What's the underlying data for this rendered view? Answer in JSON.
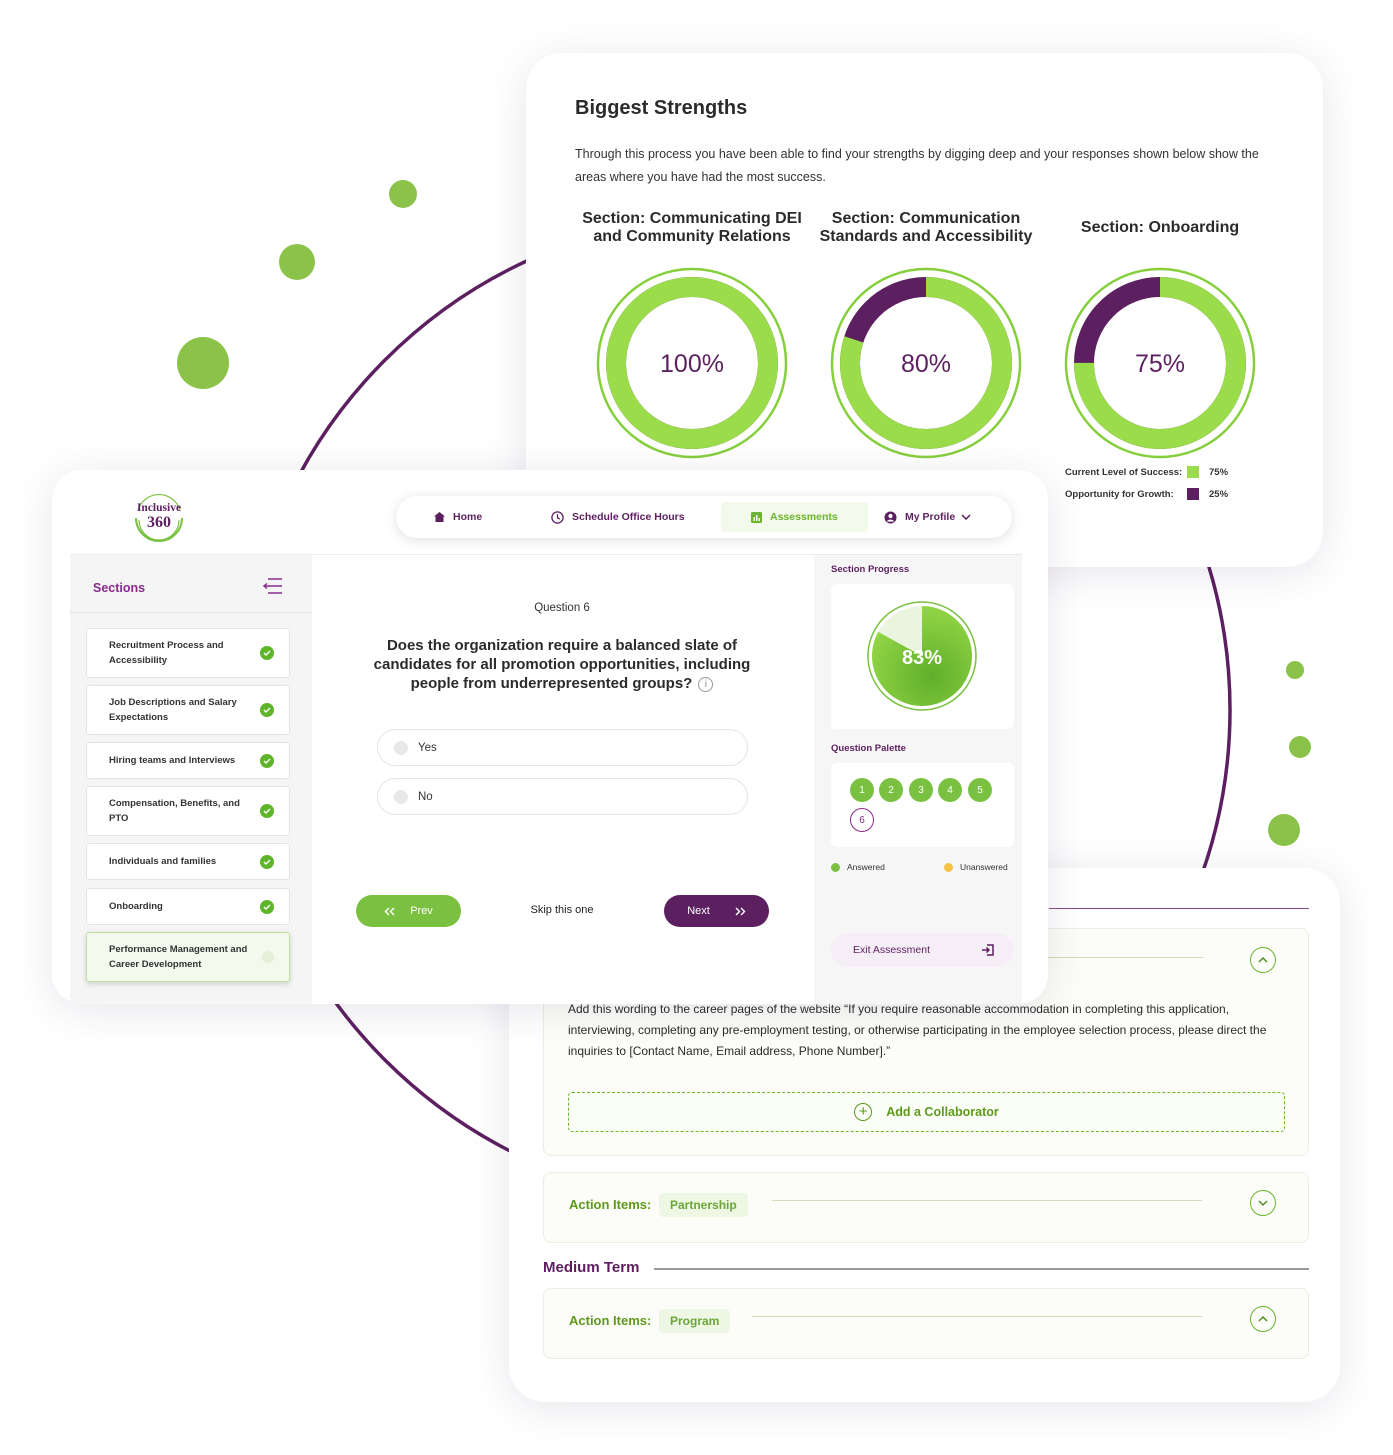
{
  "strengths": {
    "title": "Biggest Strengths",
    "description": "Through this process you have been able to find your strengths by digging deep and your responses shown below show the areas where you have had the most success.",
    "sections": [
      {
        "title": "Section: Communicating DEI and Community Relations",
        "percent_label": "100%",
        "success": 100,
        "growth": 0
      },
      {
        "title": "Section: Communication Standards and Accessibility",
        "percent_label": "80%",
        "success": 80,
        "growth": 20
      },
      {
        "title": "Section: Onboarding",
        "percent_label": "75%",
        "success": 75,
        "growth": 25
      }
    ],
    "legend": {
      "success_label": "Current Level of Success:",
      "success_value": "75%",
      "growth_label": "Opportunity for Growth:",
      "growth_value": "25%"
    },
    "colors": {
      "success": "#9bdc4b",
      "growth": "#5c1f5f",
      "ring": "#86cf3c"
    }
  },
  "nav": {
    "logo_line1": "Inclusive",
    "logo_line2": "360",
    "home": "Home",
    "schedule": "Schedule Office Hours",
    "assessments": "Assessments",
    "profile": "My Profile"
  },
  "sidebar": {
    "heading": "Sections",
    "items": [
      {
        "label": "Recruitment Process and Accessibility",
        "done": true
      },
      {
        "label": "Job Descriptions and Salary Expectations",
        "done": true
      },
      {
        "label": "Hiring teams and Interviews",
        "done": true
      },
      {
        "label": "Compensation, Benefits, and PTO",
        "done": true
      },
      {
        "label": "Individuals and families",
        "done": true
      },
      {
        "label": "Onboarding",
        "done": true
      },
      {
        "label": "Performance Management and Career Development",
        "done": false
      }
    ]
  },
  "question": {
    "number_label": "Question 6",
    "text": "Does the organization require a balanced slate of candidates for all promotion opportunities, including people from underrepresented groups?",
    "options": [
      "Yes",
      "No"
    ],
    "prev": "Prev",
    "skip": "Skip this one",
    "next": "Next"
  },
  "right_panel": {
    "progress_label": "Section Progress",
    "progress_value": 83,
    "progress_text": "83%",
    "palette_label": "Question Palette",
    "palette": [
      "1",
      "2",
      "3",
      "4",
      "5",
      "6"
    ],
    "current": "6",
    "answered": "Answered",
    "unanswered": "Unanswered",
    "exit": "Exit Assessment",
    "colors": {
      "answered": "#7ac142",
      "unanswered": "#f5c242"
    }
  },
  "actions": {
    "accordion1_text": "Add this wording to the career pages of the website “If you require reasonable accommodation in completing this application, interviewing, completing any pre-employment testing, or otherwise participating in the employee selection process, please direct the inquiries to [Contact Name, Email address, Phone Number].”",
    "add_collaborator": "Add a Collaborator",
    "action_items_label": "Action Items:",
    "chip_partnership": "Partnership",
    "medium_term": "Medium Term",
    "chip_program": "Program"
  }
}
